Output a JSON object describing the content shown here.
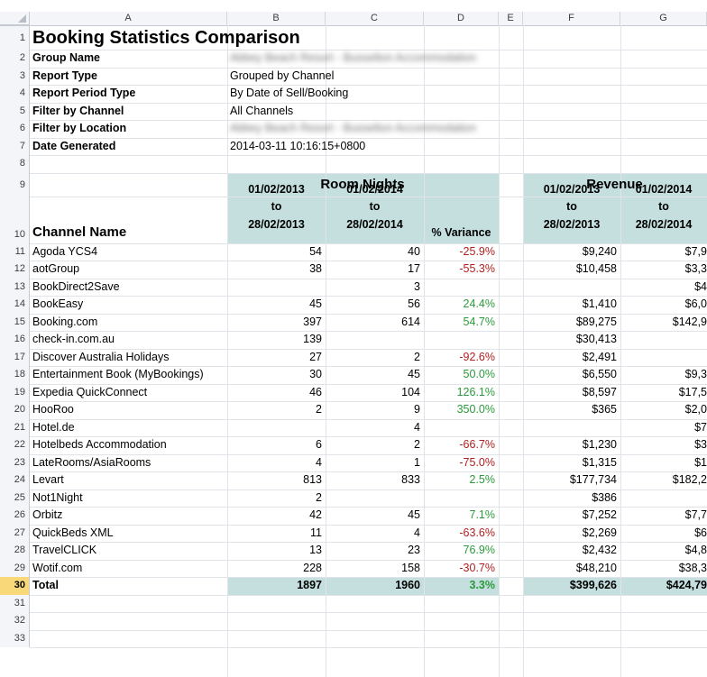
{
  "columns": [
    "A",
    "B",
    "C",
    "D",
    "E",
    "F",
    "G"
  ],
  "title": "Booking Statistics Comparison",
  "meta": [
    {
      "label": "Group Name",
      "value": "Abbey Beach Resort - Busselton Accommodation",
      "blurred": true
    },
    {
      "label": "Report Type",
      "value": "Grouped by Channel",
      "blurred": false
    },
    {
      "label": "Report Period Type",
      "value": "By Date of Sell/Booking",
      "blurred": false
    },
    {
      "label": "Filter by Channel",
      "value": "All Channels",
      "blurred": false
    },
    {
      "label": "Filter by Location",
      "value": "Abbey Beach Resort - Busselton Accommodation",
      "blurred": true
    },
    {
      "label": "Date Generated",
      "value": "2014-03-11 10:16:15+0800",
      "blurred": false
    }
  ],
  "headers": {
    "room_nights": "Room Nights",
    "revenue": "Revenue",
    "channel_name": "Channel Name",
    "period1": [
      "01/02/2013",
      "to",
      "28/02/2013"
    ],
    "period2": [
      "01/02/2014",
      "to",
      "28/02/2014"
    ],
    "variance": "% Variance"
  },
  "rows": [
    {
      "name": "Agoda YCS4",
      "rn1": "54",
      "rn2": "40",
      "var": "-25.9%",
      "rev1": "$9,240",
      "rev2": "$7,9"
    },
    {
      "name": "aotGroup",
      "rn1": "38",
      "rn2": "17",
      "var": "-55.3%",
      "rev1": "$10,458",
      "rev2": "$3,3"
    },
    {
      "name": "BookDirect2Save",
      "rn1": "",
      "rn2": "3",
      "var": "",
      "rev1": "",
      "rev2": "$4"
    },
    {
      "name": "BookEasy",
      "rn1": "45",
      "rn2": "56",
      "var": "24.4%",
      "rev1": "$1,410",
      "rev2": "$6,0"
    },
    {
      "name": "Booking.com",
      "rn1": "397",
      "rn2": "614",
      "var": "54.7%",
      "rev1": "$89,275",
      "rev2": "$142,9"
    },
    {
      "name": "check-in.com.au",
      "rn1": "139",
      "rn2": "",
      "var": "",
      "rev1": "$30,413",
      "rev2": ""
    },
    {
      "name": "Discover Australia Holidays",
      "rn1": "27",
      "rn2": "2",
      "var": "-92.6%",
      "rev1": "$2,491",
      "rev2": ""
    },
    {
      "name": "Entertainment Book (MyBookings)",
      "rn1": "30",
      "rn2": "45",
      "var": "50.0%",
      "rev1": "$6,550",
      "rev2": "$9,3"
    },
    {
      "name": "Expedia QuickConnect",
      "rn1": "46",
      "rn2": "104",
      "var": "126.1%",
      "rev1": "$8,597",
      "rev2": "$17,5"
    },
    {
      "name": "HooRoo",
      "rn1": "2",
      "rn2": "9",
      "var": "350.0%",
      "rev1": "$365",
      "rev2": "$2,0"
    },
    {
      "name": "Hotel.de",
      "rn1": "",
      "rn2": "4",
      "var": "",
      "rev1": "",
      "rev2": "$7"
    },
    {
      "name": "Hotelbeds Accommodation",
      "rn1": "6",
      "rn2": "2",
      "var": "-66.7%",
      "rev1": "$1,230",
      "rev2": "$3"
    },
    {
      "name": "LateRooms/AsiaRooms",
      "rn1": "4",
      "rn2": "1",
      "var": "-75.0%",
      "rev1": "$1,315",
      "rev2": "$1"
    },
    {
      "name": "Levart",
      "rn1": "813",
      "rn2": "833",
      "var": "2.5%",
      "rev1": "$177,734",
      "rev2": "$182,2"
    },
    {
      "name": "Not1Night",
      "rn1": "2",
      "rn2": "",
      "var": "",
      "rev1": "$386",
      "rev2": ""
    },
    {
      "name": "Orbitz",
      "rn1": "42",
      "rn2": "45",
      "var": "7.1%",
      "rev1": "$7,252",
      "rev2": "$7,7"
    },
    {
      "name": "QuickBeds XML",
      "rn1": "11",
      "rn2": "4",
      "var": "-63.6%",
      "rev1": "$2,269",
      "rev2": "$6"
    },
    {
      "name": "TravelCLICK",
      "rn1": "13",
      "rn2": "23",
      "var": "76.9%",
      "rev1": "$2,432",
      "rev2": "$4,8"
    },
    {
      "name": "Wotif.com",
      "rn1": "228",
      "rn2": "158",
      "var": "-30.7%",
      "rev1": "$48,210",
      "rev2": "$38,3"
    }
  ],
  "total": {
    "name": "Total",
    "rn1": "1897",
    "rn2": "1960",
    "var": "3.3%",
    "rev1": "$399,626",
    "rev2": "$424,79"
  },
  "colors": {
    "band": "#c5dfdf",
    "negative": "#b02020",
    "positive": "#2a9a3a",
    "selected_row": "#f8d878"
  }
}
